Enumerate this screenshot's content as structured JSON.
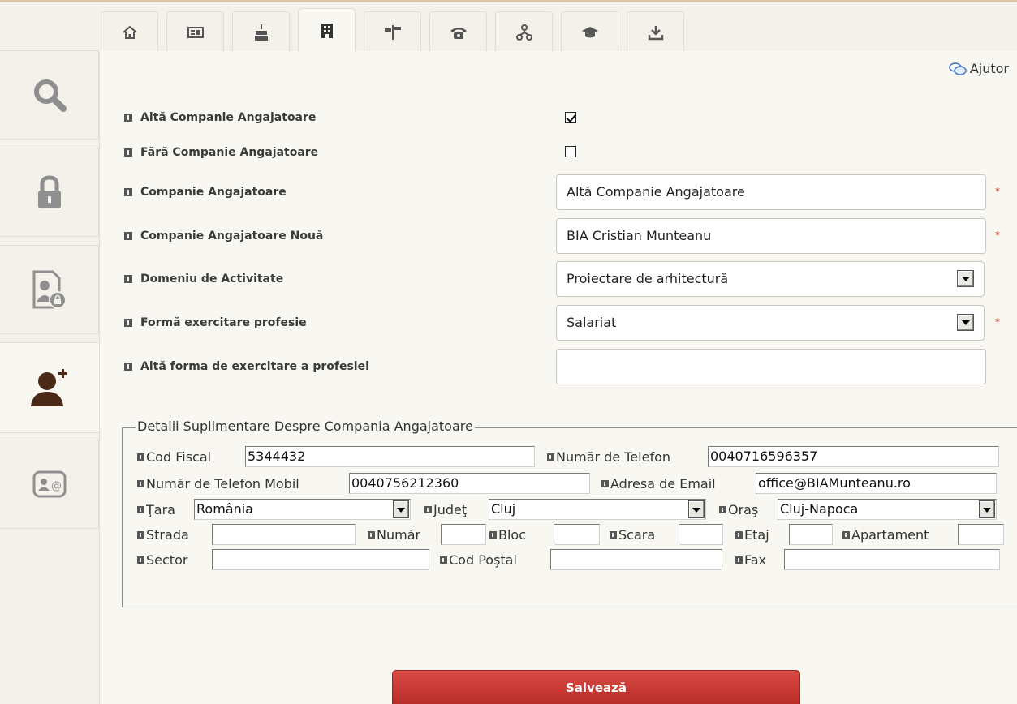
{
  "help": {
    "label": "Ajutor"
  },
  "top_tabs": [
    {
      "icon": "home-icon"
    },
    {
      "icon": "id-card-icon"
    },
    {
      "icon": "cake-icon"
    },
    {
      "icon": "building-icon",
      "active": true
    },
    {
      "icon": "signpost-icon"
    },
    {
      "icon": "phone-icon"
    },
    {
      "icon": "org-chart-icon"
    },
    {
      "icon": "graduation-cap-icon"
    },
    {
      "icon": "download-icon"
    }
  ],
  "sidebar": [
    {
      "icon": "search-icon"
    },
    {
      "icon": "lock-icon"
    },
    {
      "icon": "user-document-lock-icon"
    },
    {
      "icon": "add-user-icon",
      "active": true
    },
    {
      "icon": "contact-card-icon"
    }
  ],
  "form": {
    "alta_companie_label": "Altă Companie Angajatoare",
    "alta_companie_checked": true,
    "fara_companie_label": "Fără Companie Angajatoare",
    "fara_companie_checked": false,
    "companie_label": "Companie Angajatoare",
    "companie_value": "Altă Companie Angajatoare",
    "companie_noua_label": "Companie Angajatoare Nouă",
    "companie_noua_value": "BIA Cristian Munteanu",
    "domeniu_label": "Domeniu de Activitate",
    "domeniu_value": "Proiectare de arhitectură",
    "forma_label": "Formă exercitare profesie",
    "forma_value": "Salariat",
    "alta_forma_label": "Altă forma de exercitare a profesiei",
    "alta_forma_value": "",
    "required_mark": "*"
  },
  "details": {
    "legend": "Detalii Suplimentare Despre Compania Angajatoare",
    "cod_fiscal_label": "Cod Fiscal",
    "cod_fiscal_value": "5344432",
    "telefon_label": "Număr de Telefon",
    "telefon_value": "0040716596357",
    "mobil_label": "Număr de Telefon Mobil",
    "mobil_value": "0040756212360",
    "email_label": "Adresa de Email",
    "email_value": "office@BIAMunteanu.ro",
    "tara_label": "Ţara",
    "tara_value": "România",
    "judet_label": "Judeţ",
    "judet_value": "Cluj",
    "oras_label": "Oraş",
    "oras_value": "Cluj-Napoca",
    "strada_label": "Strada",
    "numar_label": "Număr",
    "bloc_label": "Bloc",
    "scara_label": "Scara",
    "etaj_label": "Etaj",
    "apartament_label": "Apartament",
    "sector_label": "Sector",
    "cod_postal_label": "Cod Poştal",
    "fax_label": "Fax"
  },
  "save_label": "Salvează",
  "colors": {
    "accent": "#c9332e",
    "background": "#f4f1ea",
    "panel": "#f9f7f1"
  }
}
